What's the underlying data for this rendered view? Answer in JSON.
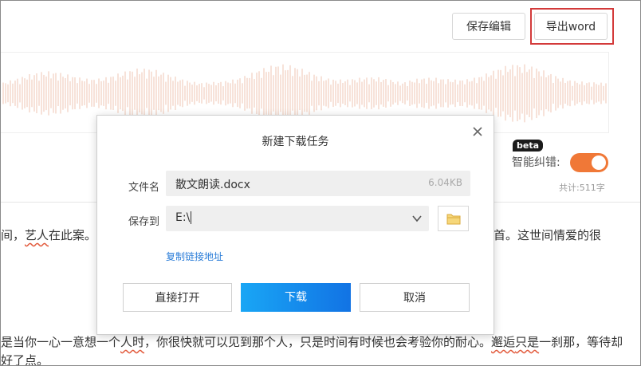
{
  "toolbar": {
    "save_edit_label": "保存编辑",
    "export_word_label": "导出word"
  },
  "options": {
    "beta_badge": "beta",
    "smart_correction_label": "智能纠错:",
    "smart_correction_on": true,
    "word_count": "共计:511字"
  },
  "article": {
    "line1_start": "间，",
    "line1_u1": "艺人",
    "line1_mid": "在此案。伊",
    "line1_right": "首。这世间情爱的很",
    "line2_start": "是当你一心一意想一个",
    "line2_u1": "人时",
    "line2_mid": "，你很快就可以见到那个人，只是时间有时候也会考验你的耐心。",
    "line2_u2": "邂逅",
    "line2_mid2": "只是",
    "line2_mid3": "一刹那，等待却",
    "line3": "好了点。"
  },
  "dialog": {
    "title": "新建下载任务",
    "filename_label": "文件名",
    "filename_value": "散文朗读.docx",
    "file_size": "6.04KB",
    "saveto_label": "保存到",
    "saveto_value": "E:\\",
    "copy_link_label": "复制链接地址",
    "open_button_label": "直接打开",
    "download_button_label": "下载",
    "cancel_button_label": "取消"
  },
  "colors": {
    "accent_orange": "#f07837",
    "highlight_red": "#d33a3a",
    "link_blue": "#2b7dd8",
    "download_gradient_start": "#19a6f5",
    "download_gradient_end": "#1273e4",
    "waveform": "#f4d9cc"
  },
  "icons": {
    "close": "close-icon",
    "dropdown": "chevron-down-icon",
    "folder": "folder-icon"
  }
}
